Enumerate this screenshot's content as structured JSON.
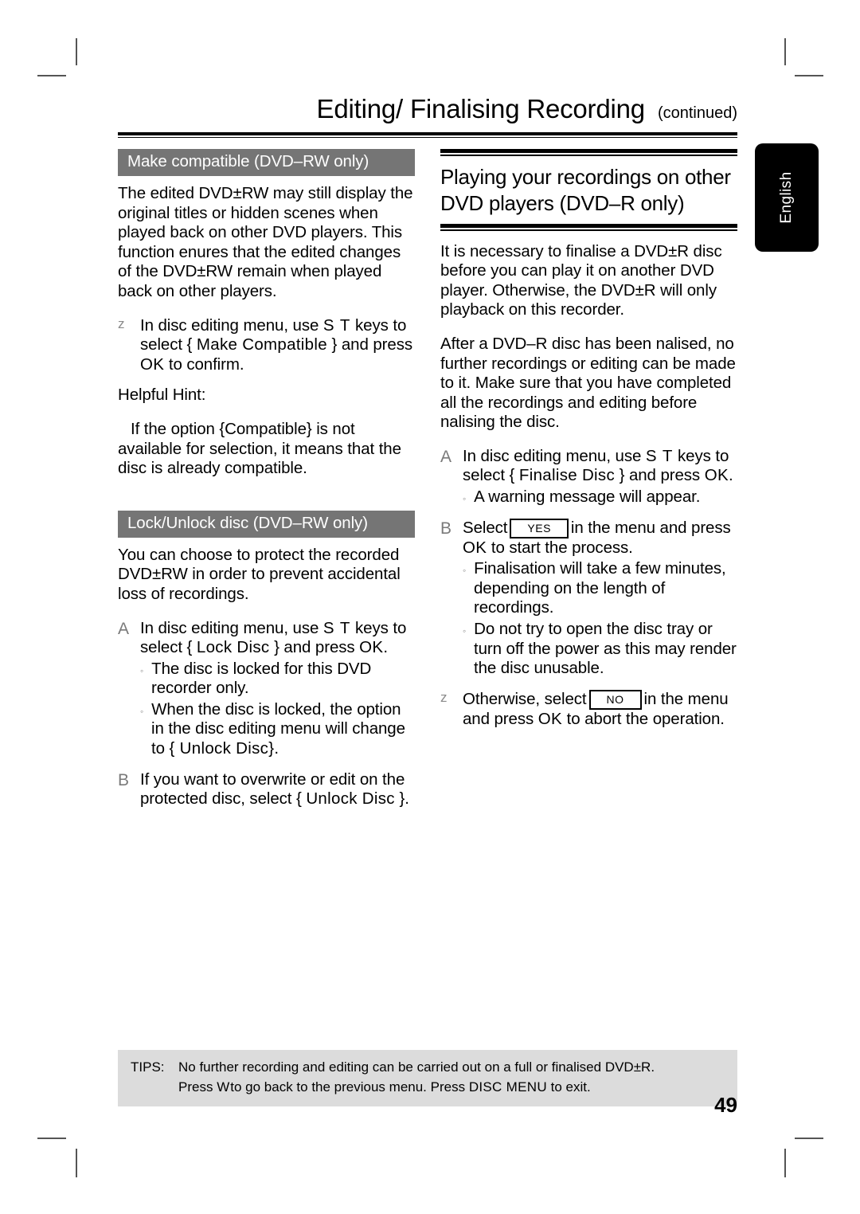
{
  "header": {
    "title": "Editing/ Finalising Recording",
    "continued": "(continued)"
  },
  "side_tab": {
    "language": "English"
  },
  "left_column": {
    "section1": {
      "heading": "Make compatible (DVD–RW only)",
      "paragraph": "The edited DVD±RW may still display the original titles or hidden scenes when played back on other DVD players. This function enures that the edited changes of the DVD±RW remain when played back on other players.",
      "step": {
        "marker": "z",
        "text_a": "In disc editing menu, use",
        "keys": "S T",
        "text_b": "keys to select {",
        "menu_item": "Make Compatible",
        "text_c": "} and press",
        "ok": "OK",
        "text_d": "to confirm."
      },
      "hint_title": "Helpful Hint:",
      "hint_body": "If the option {Compatible} is not available for selection, it means that the disc is already compatible."
    },
    "section2": {
      "heading": "Lock/Unlock disc (DVD–RW only)",
      "paragraph": "You can choose to protect the recorded DVD±RW in order to prevent accidental loss of recordings.",
      "step_a": {
        "marker": "A",
        "text_a": "In disc editing menu, use",
        "keys": "S T",
        "text_b": "keys to select {",
        "menu_item": "Lock Disc",
        "text_c": "} and press",
        "ok": "OK",
        "text_d": ".",
        "bullets": [
          "The disc is locked for this DVD recorder only.",
          "When the disc is locked, the option in the disc editing menu will change to"
        ],
        "bullet2_menu_item": "Unlock Disc",
        "bullet2_tail": "}."
      },
      "step_b": {
        "marker": "B",
        "text_a": "If you want to overwrite or edit on the protected disc, select {",
        "menu_item": "Unlock Disc",
        "text_b": "}."
      }
    }
  },
  "right_column": {
    "heading": "Playing your recordings on other DVD players (DVD–R only)",
    "paragraph1": "It is necessary to finalise a DVD±R disc before you can play it on another DVD player. Otherwise, the DVD±R will only playback on this recorder.",
    "paragraph2": "After a DVD–R disc has been  nalised, no further recordings or editing can be made to it. Make sure that you have completed all the recordings and editing before  nalising the disc.",
    "step_a": {
      "marker": "A",
      "text_a": "In disc editing menu, use",
      "keys": "S T",
      "text_b": "keys to select {",
      "menu_item": "Finalise Disc",
      "text_c": "} and press",
      "ok": "OK",
      "text_d": ".",
      "bullet": "A warning message will appear."
    },
    "step_b": {
      "marker": "B",
      "text_a": "Select",
      "button": "YES",
      "text_b": "in the menu and press",
      "ok": "OK",
      "text_c": "to start the process.",
      "bullets": [
        "Finalisation will take a few minutes, depending on the length of recordings.",
        "Do not try to open the disc tray or turn off the power as this may render the disc unusable."
      ]
    },
    "step_z": {
      "marker": "z",
      "text_a": "Otherwise, select",
      "button": "NO",
      "text_b": "in the menu and press",
      "ok": "OK",
      "text_c": "to abort the operation."
    }
  },
  "tips": {
    "label": "TIPS:",
    "line1": "No further recording and editing can be carried out on a full or finalised DVD±R.",
    "line2_a": "Press",
    "line2_back_key": "W",
    "line2_b": "to go back to the previous menu. Press",
    "line2_menu_key": "DISC MENU",
    "line2_c": "to exit."
  },
  "page_number": "49",
  "colors": {
    "section_heading_bg": "#757575",
    "tips_bg": "#dcdcdc",
    "tab_bg": "#000000",
    "marker": "#7a7a7a"
  }
}
